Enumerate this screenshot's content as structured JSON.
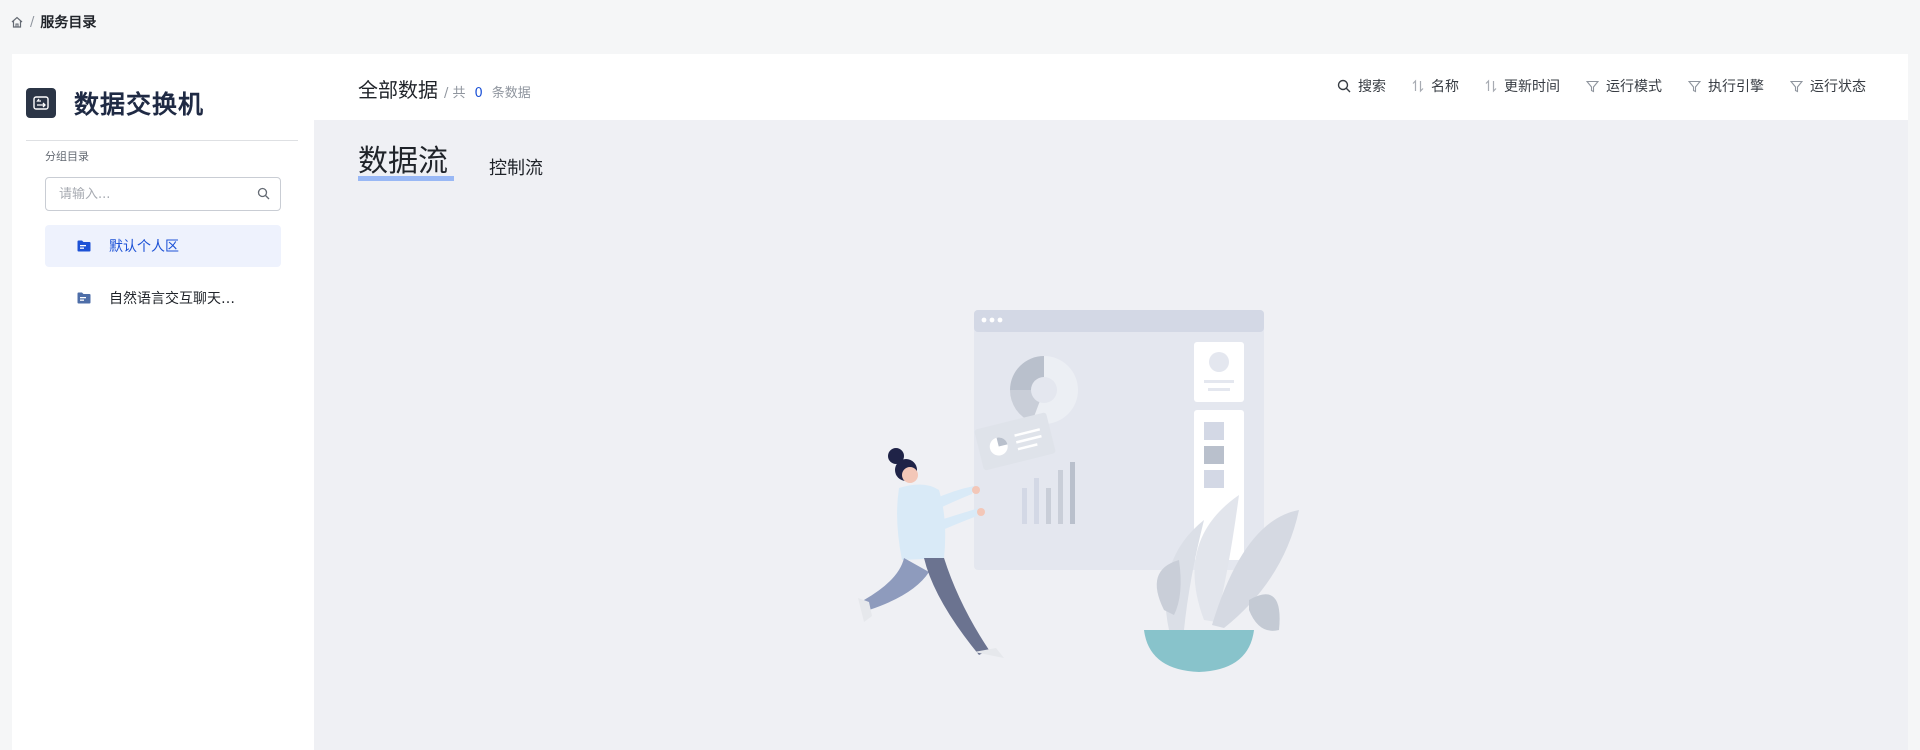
{
  "breadcrumb": {
    "home_icon": "home-icon",
    "separator": "/",
    "current": "服务目录"
  },
  "sidebar": {
    "app_icon": "exchange-machine-icon",
    "app_title": "数据交换机",
    "group_label": "分组目录",
    "search": {
      "placeholder": "请输入...",
      "value": "",
      "icon": "search-icon"
    },
    "groups": [
      {
        "label": "默认个人区",
        "icon": "folder-icon",
        "active": true
      },
      {
        "label": "自然语言交互聊天…",
        "icon": "folder-icon",
        "active": false
      }
    ]
  },
  "topbar": {
    "title": "全部数据",
    "count_prefix": "/ 共",
    "count": "0",
    "count_suffix": "条数据",
    "tools": [
      {
        "label": "搜索",
        "icon": "search-icon"
      },
      {
        "label": "名称",
        "icon": "sort-icon"
      },
      {
        "label": "更新时间",
        "icon": "sort-icon"
      },
      {
        "label": "运行模式",
        "icon": "filter-icon"
      },
      {
        "label": "执行引擎",
        "icon": "filter-icon"
      },
      {
        "label": "运行状态",
        "icon": "filter-icon"
      }
    ]
  },
  "content": {
    "tabs": [
      {
        "label": "数据流",
        "active": true
      },
      {
        "label": "控制流",
        "active": false
      }
    ],
    "empty_illustration": "empty-state-illustration"
  },
  "colors": {
    "accent": "#1d52d6",
    "active_bg": "#eef2fd",
    "content_bg": "#eff0f4",
    "tab_underline": "#8fb1f5"
  }
}
